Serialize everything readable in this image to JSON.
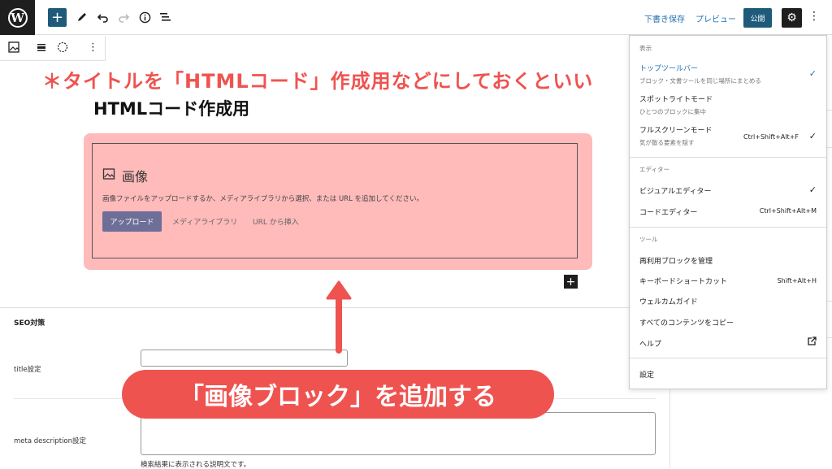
{
  "topbar": {
    "logo": "W",
    "add_icon": "+",
    "save_draft": "下書き保存",
    "preview": "プレビュー",
    "publish": "公開",
    "settings_icon": "⚙",
    "more_icon": "⋮"
  },
  "annotations": {
    "top": "＊タイトルを「HTMLコード」作成用などにしておくといい",
    "pill": "「画像ブロック」を追加する"
  },
  "post": {
    "title": "HTMLコード作成用"
  },
  "image_block": {
    "title": "画像",
    "description": "画像ファイルをアップロードするか、メディアライブラリから選択、または URL を追加してください。",
    "upload": "アップロード",
    "media_library": "メディアライブラリ",
    "insert_url": "URL から挿入"
  },
  "seo": {
    "section_title": "SEO対策",
    "title_label": "title設定",
    "meta_label": "meta description設定",
    "meta_help": "検索結果に表示される説明文です。"
  },
  "menu": {
    "section_view": "表示",
    "top_toolbar": "トップツールバー",
    "top_toolbar_desc": "ブロック・文書ツールを同じ場所にまとめる",
    "spotlight": "スポットライトモード",
    "spotlight_desc": "ひとつのブロックに集中",
    "fullscreen": "フルスクリーンモード",
    "fullscreen_desc": "気が散る要素を隠す",
    "fullscreen_shortcut": "Ctrl+Shift+Alt+F",
    "section_editor": "エディター",
    "visual_editor": "ビジュアルエディター",
    "code_editor": "コードエディター",
    "code_editor_shortcut": "Ctrl+Shift+Alt+M",
    "section_tools": "ツール",
    "manage_blocks": "再利用ブロックを管理",
    "keyboard_shortcuts": "キーボードショートカット",
    "keyboard_shortcuts_shortcut": "Shift+Alt+H",
    "welcome_guide": "ウェルカムガイド",
    "copy_all": "すべてのコンテンツをコピー",
    "help": "ヘルプ",
    "preferences": "設定",
    "check": "✓"
  },
  "colors": {
    "accent": "#2271b1",
    "annotation_red": "#ef5350",
    "highlight": "#ffbaba",
    "upload_button": "#6e6e98"
  }
}
